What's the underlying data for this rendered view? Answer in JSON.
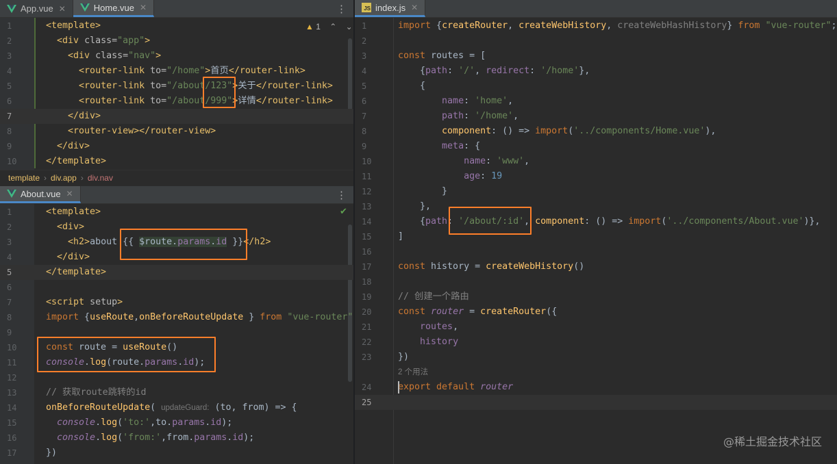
{
  "left_top": {
    "tabs": [
      {
        "label": "App.vue",
        "active": false
      },
      {
        "label": "Home.vue",
        "active": true
      }
    ],
    "warning_count": "1",
    "lines": [
      {
        "n": "1",
        "html": "<span class=\"t-tag\">&lt;template&gt;</span>"
      },
      {
        "n": "2",
        "html": "  <span class=\"t-tag\">&lt;div</span> <span class=\"t-attr\">class=</span><span class=\"t-str\">\"app\"</span><span class=\"t-tag\">&gt;</span>"
      },
      {
        "n": "3",
        "html": "    <span class=\"t-tag\">&lt;div</span> <span class=\"t-attr\">class=</span><span class=\"t-str\">\"nav\"</span><span class=\"t-tag\">&gt;</span>"
      },
      {
        "n": "4",
        "html": "      <span class=\"t-tag\">&lt;router-link</span> <span class=\"t-attr\">to=</span><span class=\"t-str\">\"/home\"</span><span class=\"t-tag\">&gt;</span><span class=\"t-cnmix\">首页</span><span class=\"t-tag\">&lt;/router-link&gt;</span>"
      },
      {
        "n": "5",
        "html": "      <span class=\"t-tag\">&lt;router-link</span> <span class=\"t-attr\">to=</span><span class=\"t-str\">\"/about/123\"</span><span class=\"t-tag\">&gt;</span><span class=\"t-cnmix\">关于</span><span class=\"t-tag\">&lt;/router-link&gt;</span>"
      },
      {
        "n": "6",
        "html": "      <span class=\"t-tag\">&lt;router-link</span> <span class=\"t-attr\">to=</span><span class=\"t-str\">\"/about/999\"</span><span class=\"t-tag\">&gt;</span><span class=\"t-cnmix\">详情</span><span class=\"t-tag\">&lt;/router-link&gt;</span>"
      },
      {
        "n": "7",
        "html": "    <span class=\"t-tag\">&lt;/div&gt;</span>",
        "current": true
      },
      {
        "n": "8",
        "html": "    <span class=\"t-tag\">&lt;router-view&gt;&lt;/router-view&gt;</span>"
      },
      {
        "n": "9",
        "html": "  <span class=\"t-tag\">&lt;/div&gt;</span>"
      },
      {
        "n": "10",
        "html": "<span class=\"t-tag\">&lt;/template&gt;</span>"
      }
    ],
    "breadcrumb": [
      "template",
      "div.app",
      "div.nav"
    ]
  },
  "left_bottom": {
    "tab": "About.vue",
    "lines": [
      {
        "n": "1",
        "html": "<span class=\"t-tag\">&lt;template&gt;</span>"
      },
      {
        "n": "2",
        "html": "  <span class=\"t-tag\">&lt;div&gt;</span>"
      },
      {
        "n": "3",
        "html": "    <span class=\"t-tag\">&lt;h2&gt;</span>about <span class=\"t-rt\">{{ </span><span class=\"t-exp\">$route.<span class=\"t-prop\">params</span>.<span class=\"t-prop\">id</span></span><span class=\"t-rt\"> }}</span><span class=\"t-tag\">&lt;/h2&gt;</span>"
      },
      {
        "n": "4",
        "html": "  <span class=\"t-tag\">&lt;/div&gt;</span>"
      },
      {
        "n": "5",
        "html": "<span class=\"t-tag\">&lt;/template&gt;</span>",
        "current": true
      },
      {
        "n": "6",
        "html": ""
      },
      {
        "n": "7",
        "html": "<span class=\"t-tag\">&lt;script</span> <span class=\"t-attr\">setup</span><span class=\"t-tag\">&gt;</span>"
      },
      {
        "n": "8",
        "html": "<span class=\"t-kw\">import</span> {<span class=\"t-fn\">useRoute</span>,<span class=\"t-fn\">onBeforeRouteUpdate</span> } <span class=\"t-kw\">from</span> <span class=\"t-str\">\"vue-router\"</span>"
      },
      {
        "n": "9",
        "html": ""
      },
      {
        "n": "10",
        "html": "<span class=\"t-kw\">const</span> route = <span class=\"t-fn\">useRoute</span>()"
      },
      {
        "n": "11",
        "html": "<span class=\"t-it\">console</span>.<span class=\"t-fn\">log</span>(route.<span class=\"t-prop\">params</span>.<span class=\"t-prop\">id</span>);"
      },
      {
        "n": "12",
        "html": ""
      },
      {
        "n": "13",
        "html": "<span class=\"t-com\">// 获取route跳转的id</span>"
      },
      {
        "n": "14",
        "html": "<span class=\"t-fn\">onBeforeRouteUpdate</span>( <span class=\"t-hint\">updateGuard:</span> (to, from) => {"
      },
      {
        "n": "15",
        "html": "  <span class=\"t-it\">console</span>.<span class=\"t-fn\">log</span>(<span class=\"t-str\">'to:'</span>,to.<span class=\"t-prop\">params</span>.<span class=\"t-prop\">id</span>);"
      },
      {
        "n": "16",
        "html": "  <span class=\"t-it\">console</span>.<span class=\"t-fn\">log</span>(<span class=\"t-str\">'from:'</span>,from.<span class=\"t-prop\">params</span>.<span class=\"t-prop\">id</span>);"
      },
      {
        "n": "17",
        "html": "})"
      }
    ]
  },
  "right": {
    "tab": "index.js",
    "lines": [
      {
        "n": "1",
        "html": "<span class=\"t-kw\">import</span> {<span class=\"t-fn\">createRouter</span>, <span class=\"t-fn\">createWebHistory</span>, <span class=\"t-com\">createWebHashHistory</span>} <span class=\"t-kw\">from</span> <span class=\"t-str\">\"vue-router\"</span>;"
      },
      {
        "n": "2",
        "html": ""
      },
      {
        "n": "3",
        "html": "<span class=\"t-kw\">const</span> routes = ["
      },
      {
        "n": "4",
        "html": "    {<span class=\"t-prop\">path</span>: <span class=\"t-str\">'/'</span>, <span class=\"t-prop\">redirect</span>: <span class=\"t-str\">'/home'</span>},"
      },
      {
        "n": "5",
        "html": "    {"
      },
      {
        "n": "6",
        "html": "        <span class=\"t-prop\">name</span>: <span class=\"t-str\">'home'</span>,"
      },
      {
        "n": "7",
        "html": "        <span class=\"t-prop\">path</span>: <span class=\"t-str\">'/home'</span>,"
      },
      {
        "n": "8",
        "html": "        <span class=\"t-fn\">component</span>: () => <span class=\"t-kw\">import</span>(<span class=\"t-str\">'../components/Home.vue'</span>),"
      },
      {
        "n": "9",
        "html": "        <span class=\"t-prop\">meta</span>: {"
      },
      {
        "n": "10",
        "html": "            <span class=\"t-prop\">name</span>: <span class=\"t-str\">'www'</span>,"
      },
      {
        "n": "11",
        "html": "            <span class=\"t-prop\">age</span>: <span class=\"t-num\">19</span>"
      },
      {
        "n": "12",
        "html": "        }"
      },
      {
        "n": "13",
        "html": "    },"
      },
      {
        "n": "14",
        "html": "    {<span class=\"t-prop\">path</span>: <span class=\"t-str\">'/about/:id'</span>, <span class=\"t-fn\">component</span>: () => <span class=\"t-kw\">import</span>(<span class=\"t-str\">'../components/About.vue'</span>)},"
      },
      {
        "n": "15",
        "html": "]"
      },
      {
        "n": "16",
        "html": ""
      },
      {
        "n": "17",
        "html": "<span class=\"t-kw\">const</span> history = <span class=\"t-fn\">createWebHistory</span>()"
      },
      {
        "n": "18",
        "html": ""
      },
      {
        "n": "19",
        "html": "<span class=\"t-com\">// 创建一个路由</span>"
      },
      {
        "n": "20",
        "html": "<span class=\"t-kw\">const</span> <span class=\"t-it\">router</span> = <span class=\"t-fn\">createRouter</span>({"
      },
      {
        "n": "21",
        "html": "    <span class=\"t-prop\">routes</span>,"
      },
      {
        "n": "22",
        "html": "    <span class=\"t-prop\">history</span>"
      },
      {
        "n": "23",
        "html": "})"
      },
      {
        "n": "",
        "html": "<span class=\"t-hint\">2 个用法</span>"
      },
      {
        "n": "24",
        "html": "<span class=\"t-kw\">export default</span> <span class=\"t-it\">router</span>"
      },
      {
        "n": "25",
        "html": "",
        "current": true
      }
    ]
  },
  "watermark": "@稀土掘金技术社区"
}
